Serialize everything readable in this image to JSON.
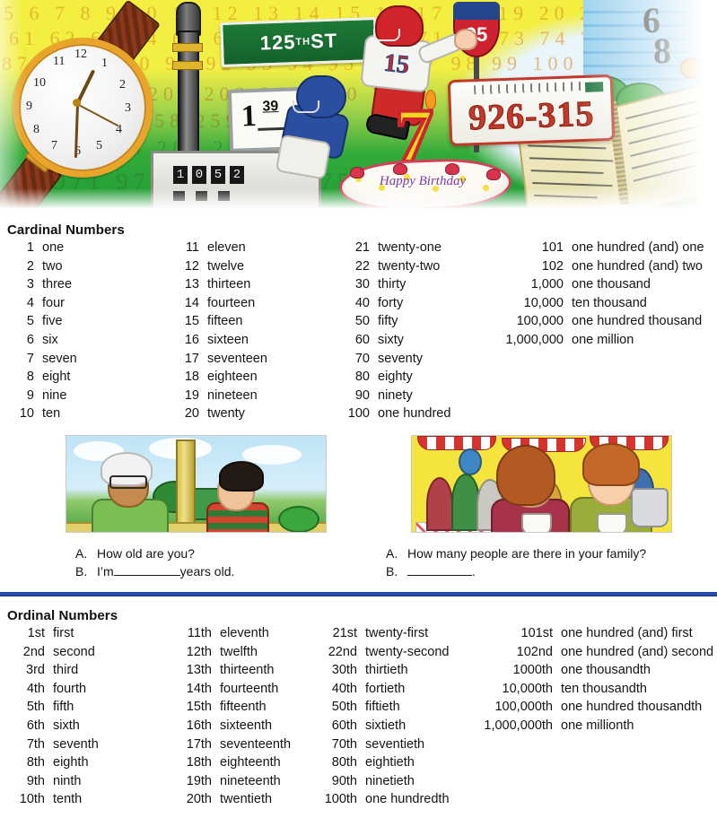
{
  "hero": {
    "alt": "illustration of things with numbers",
    "street_sign": "125",
    "street_sign_sup": "TH",
    "street_sign_tail": " ST",
    "price_sign_whole": "1",
    "price_sign_cents": "39",
    "meter_digits": [
      "1",
      "0",
      "5",
      "2"
    ],
    "jersey_number": "15",
    "cake_candle": "7",
    "cake_text": "Happy Birthday",
    "route_shield": "95",
    "license_plate": "926-315",
    "house_number_1": "6",
    "house_number_2": "8",
    "bg_numbers_rows": [
      "5 6 7 8 9 10 11 12 13 14 15 16 17 18 19 20 21 22 23 24 25 26 27 28 29 30 31 32",
      "61 62 63 64 65 66 67 68 69 70 71 72 73 74 75 76 77 78",
      "87 88 89 90 91 92 93 94 95 96 97 98 99 100 101 102 103 104",
      "205 206 207 208 209 210 211",
      "256 257 258 259 260 261",
      "283 284 285 286 287",
      "971 972 973 974 975 976"
    ]
  },
  "cardinal": {
    "title": "Cardinal Numbers",
    "columns": [
      [
        {
          "n": "1",
          "w": "one"
        },
        {
          "n": "2",
          "w": "two"
        },
        {
          "n": "3",
          "w": "three"
        },
        {
          "n": "4",
          "w": "four"
        },
        {
          "n": "5",
          "w": "five"
        },
        {
          "n": "6",
          "w": "six"
        },
        {
          "n": "7",
          "w": "seven"
        },
        {
          "n": "8",
          "w": "eight"
        },
        {
          "n": "9",
          "w": "nine"
        },
        {
          "n": "10",
          "w": "ten"
        }
      ],
      [
        {
          "n": "11",
          "w": "eleven"
        },
        {
          "n": "12",
          "w": "twelve"
        },
        {
          "n": "13",
          "w": "thirteen"
        },
        {
          "n": "14",
          "w": "fourteen"
        },
        {
          "n": "15",
          "w": "fifteen"
        },
        {
          "n": "16",
          "w": "sixteen"
        },
        {
          "n": "17",
          "w": "seventeen"
        },
        {
          "n": "18",
          "w": "eighteen"
        },
        {
          "n": "19",
          "w": "nineteen"
        },
        {
          "n": "20",
          "w": "twenty"
        }
      ],
      [
        {
          "n": "21",
          "w": "twenty-one"
        },
        {
          "n": "22",
          "w": "twenty-two"
        },
        {
          "n": "30",
          "w": "thirty"
        },
        {
          "n": "40",
          "w": "forty"
        },
        {
          "n": "50",
          "w": "fifty"
        },
        {
          "n": "60",
          "w": "sixty"
        },
        {
          "n": "70",
          "w": "seventy"
        },
        {
          "n": "80",
          "w": "eighty"
        },
        {
          "n": "90",
          "w": "ninety"
        },
        {
          "n": "100",
          "w": "one hundred"
        }
      ],
      [
        {
          "n": "101",
          "w": "one hundred (and) one"
        },
        {
          "n": "102",
          "w": "one hundred (and) two"
        },
        {
          "n": "1,000",
          "w": "one thousand"
        },
        {
          "n": "10,000",
          "w": "ten thousand"
        },
        {
          "n": "100,000",
          "w": "one hundred thousand"
        },
        {
          "n": "1,000,000",
          "w": "one million"
        }
      ]
    ]
  },
  "dialogues": [
    {
      "a_label": "A.",
      "a_text": "How old are you?",
      "b_label": "B.",
      "b_before": "I’m",
      "b_after": "years old."
    },
    {
      "a_label": "A.",
      "a_text": "How many people are there in your family?",
      "b_label": "B.",
      "b_before": "",
      "b_after": "."
    }
  ],
  "ordinal": {
    "title": "Ordinal Numbers",
    "columns": [
      [
        {
          "n": "1st",
          "w": "first"
        },
        {
          "n": "2nd",
          "w": "second"
        },
        {
          "n": "3rd",
          "w": "third"
        },
        {
          "n": "4th",
          "w": "fourth"
        },
        {
          "n": "5th",
          "w": "fifth"
        },
        {
          "n": "6th",
          "w": "sixth"
        },
        {
          "n": "7th",
          "w": "seventh"
        },
        {
          "n": "8th",
          "w": "eighth"
        },
        {
          "n": "9th",
          "w": "ninth"
        },
        {
          "n": "10th",
          "w": "tenth"
        }
      ],
      [
        {
          "n": "11th",
          "w": "eleventh"
        },
        {
          "n": "12th",
          "w": "twelfth"
        },
        {
          "n": "13th",
          "w": "thirteenth"
        },
        {
          "n": "14th",
          "w": "fourteenth"
        },
        {
          "n": "15th",
          "w": "fifteenth"
        },
        {
          "n": "16th",
          "w": "sixteenth"
        },
        {
          "n": "17th",
          "w": "seventeenth"
        },
        {
          "n": "18th",
          "w": "eighteenth"
        },
        {
          "n": "19th",
          "w": "nineteenth"
        },
        {
          "n": "20th",
          "w": "twentieth"
        }
      ],
      [
        {
          "n": "21st",
          "w": "twenty-first"
        },
        {
          "n": "22nd",
          "w": "twenty-second"
        },
        {
          "n": "30th",
          "w": "thirtieth"
        },
        {
          "n": "40th",
          "w": "fortieth"
        },
        {
          "n": "50th",
          "w": "fiftieth"
        },
        {
          "n": "60th",
          "w": "sixtieth"
        },
        {
          "n": "70th",
          "w": "seventieth"
        },
        {
          "n": "80th",
          "w": "eightieth"
        },
        {
          "n": "90th",
          "w": "ninetieth"
        },
        {
          "n": "100th",
          "w": "one hundredth"
        }
      ],
      [
        {
          "n": "101st",
          "w": "one hundred (and) first"
        },
        {
          "n": "102nd",
          "w": "one hundred (and) second"
        },
        {
          "n": "1000th",
          "w": "one thousandth"
        },
        {
          "n": "10,000th",
          "w": "ten thousandth"
        },
        {
          "n": "100,000th",
          "w": "one hundred thousandth"
        },
        {
          "n": "1,000,000th",
          "w": "one millionth"
        }
      ]
    ]
  },
  "colors": {
    "divider_blue": "#2a4fb5",
    "sign_green": "#1d7a37",
    "plate_red": "#c0392b",
    "text": "#141414"
  }
}
